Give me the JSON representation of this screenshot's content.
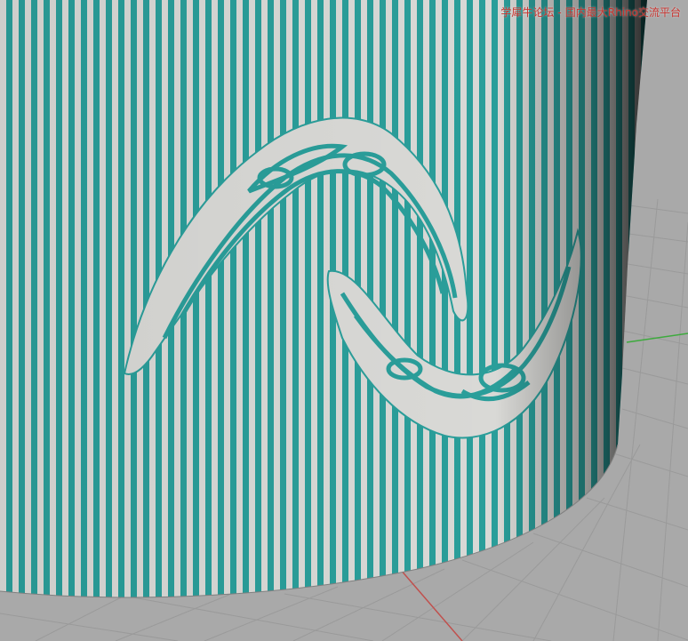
{
  "watermark": {
    "forum_name": "学犀牛论坛",
    "separator": "-",
    "tagline": "国内最大Rhino交流平台"
  },
  "viewport": {
    "background": "#a9a9a9",
    "grid_line_color": "#9a9a9a",
    "x_axis_color": "#c0504d",
    "y_axis_color": "#3daa3d",
    "stripe_teal": "#2a9e9a",
    "stripe_light": "#d9d9d6"
  }
}
